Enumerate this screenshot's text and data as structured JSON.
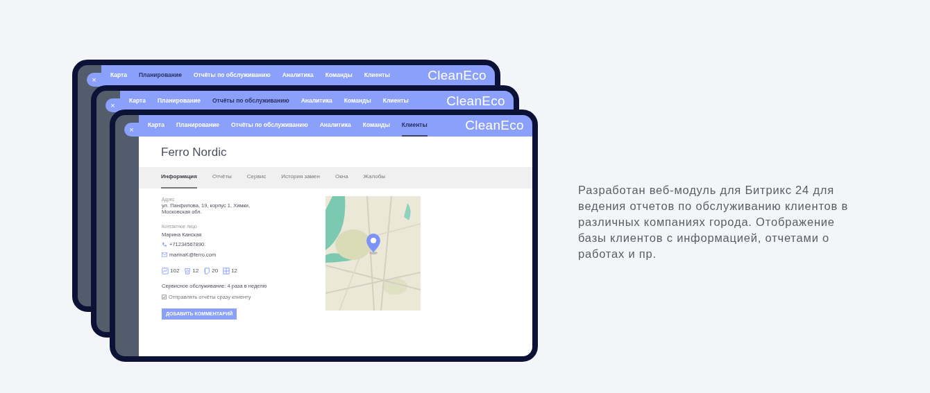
{
  "screens": [
    {
      "nav": [
        {
          "label": "Карта",
          "selected": false
        },
        {
          "label": "Планирование",
          "selected": true
        },
        {
          "label": "Отчёты по обслуживанию",
          "selected": false
        },
        {
          "label": "Аналитика",
          "selected": false
        },
        {
          "label": "Команды",
          "selected": false
        },
        {
          "label": "Клиенты",
          "selected": false
        }
      ],
      "logo": "CleanEco",
      "close": "×"
    },
    {
      "nav": [
        {
          "label": "Карта",
          "selected": false
        },
        {
          "label": "Планирование",
          "selected": false
        },
        {
          "label": "Отчёты по обслуживанию",
          "selected": true
        },
        {
          "label": "Аналитика",
          "selected": false
        },
        {
          "label": "Команды",
          "selected": false
        },
        {
          "label": "Клиенты",
          "selected": false
        }
      ],
      "logo": "CleanEco",
      "close": "×"
    },
    {
      "nav": [
        {
          "label": "Карта",
          "selected": false
        },
        {
          "label": "Планирование",
          "selected": false
        },
        {
          "label": "Отчёты по обслуживанию",
          "selected": false
        },
        {
          "label": "Аналитика",
          "selected": false
        },
        {
          "label": "Команды",
          "selected": false
        },
        {
          "label": "Клиенты",
          "selected": true
        }
      ],
      "logo": "CleanEco",
      "close": "×",
      "detail": {
        "title": "Ferro Nordic",
        "tabs": [
          {
            "label": "Информация",
            "selected": true
          },
          {
            "label": "Отчёты",
            "selected": false
          },
          {
            "label": "Сервис",
            "selected": false
          },
          {
            "label": "История замен",
            "selected": false
          },
          {
            "label": "Окна",
            "selected": false
          },
          {
            "label": "Жалобы",
            "selected": false
          }
        ],
        "address_label": "Адрес",
        "address": "ул. Панфилова, 19, корпус 1, Химки, Московская обл.",
        "contact_label": "Контактное лицо",
        "contact_name": "Марина Канская",
        "phone": "+71234567890",
        "email": "marinaK@ferro.com",
        "counters": [
          {
            "kind": "chart",
            "value": "102"
          },
          {
            "kind": "bin",
            "value": "12"
          },
          {
            "kind": "page",
            "value": "20"
          },
          {
            "kind": "grid",
            "value": "12"
          }
        ],
        "service": "Сервисное обслуживание: 4 раза в неделю",
        "send_reports": {
          "label": "Отправлять отчёты сразу клиенту",
          "checked": true
        },
        "button": "ДОБАВИТЬ КОММЕНТАРИЙ"
      }
    }
  ],
  "description": "Разработан веб-модуль для Битрикс 24 для ведения отчетов по обслуживанию клиентов в различных компаниях города. Отображение базы клиентов с информацией, отчетами о работах и пр."
}
